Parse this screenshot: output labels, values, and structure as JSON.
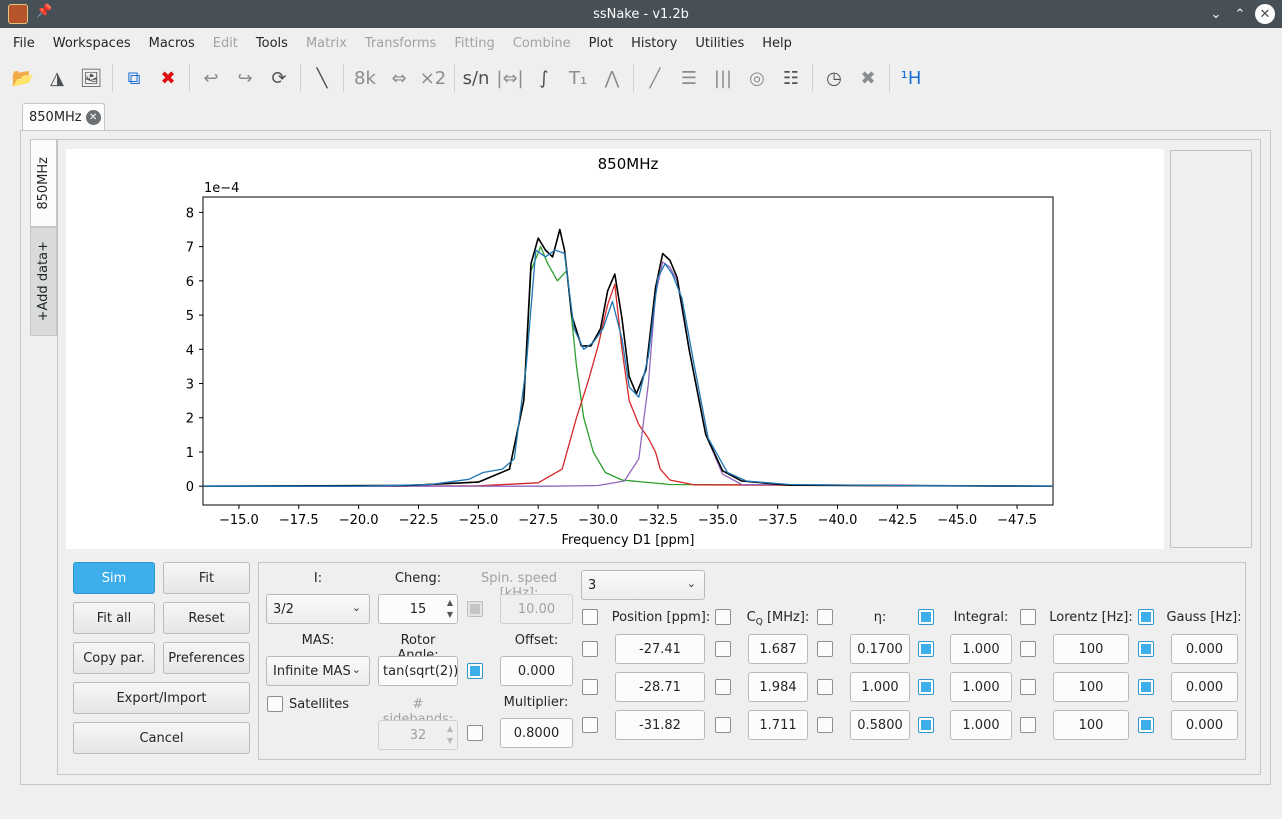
{
  "window": {
    "title": "ssNake - v1.2b"
  },
  "menu": [
    "File",
    "Workspaces",
    "Macros",
    "Edit",
    "Tools",
    "Matrix",
    "Transforms",
    "Fitting",
    "Combine",
    "Plot",
    "History",
    "Utilities",
    "Help"
  ],
  "menu_disabled": [
    "Edit",
    "Matrix",
    "Transforms",
    "Fitting",
    "Combine"
  ],
  "toolbar": [
    {
      "name": "open-icon",
      "glyph": "📂",
      "style": "dark"
    },
    {
      "name": "nmr-icon",
      "glyph": "◮",
      "style": "dark"
    },
    {
      "name": "image-icon",
      "glyph": "🖼",
      "style": "dark"
    },
    {
      "sep": true
    },
    {
      "name": "copy-icon",
      "glyph": "⧉",
      "style": "blue"
    },
    {
      "name": "delete-icon",
      "glyph": "✖",
      "style": "red"
    },
    {
      "sep": true
    },
    {
      "name": "undo-icon",
      "glyph": "↩",
      "style": ""
    },
    {
      "name": "redo-icon",
      "glyph": "↪",
      "style": ""
    },
    {
      "name": "reload-icon",
      "glyph": "⟳",
      "style": "dark"
    },
    {
      "sep": true
    },
    {
      "name": "phase-icon",
      "glyph": "╲",
      "style": "dark"
    },
    {
      "sep": true
    },
    {
      "name": "8k-icon",
      "glyph": "8k",
      "style": ""
    },
    {
      "name": "shift-icon",
      "glyph": "⇔",
      "style": ""
    },
    {
      "name": "x2-icon",
      "glyph": "×2",
      "style": ""
    },
    {
      "sep": true
    },
    {
      "name": "snr-icon",
      "glyph": "s/n",
      "style": "dark"
    },
    {
      "name": "fwhm-icon",
      "glyph": "|⇔|",
      "style": ""
    },
    {
      "name": "integral-icon",
      "glyph": "∫",
      "style": "dark"
    },
    {
      "name": "t1-icon",
      "glyph": "T₁",
      "style": ""
    },
    {
      "name": "peak-icon",
      "glyph": "⋀",
      "style": ""
    },
    {
      "sep": true
    },
    {
      "name": "diagonal-icon",
      "glyph": "╱",
      "style": ""
    },
    {
      "name": "stack-icon",
      "glyph": "☰",
      "style": ""
    },
    {
      "name": "array-icon",
      "glyph": "|||",
      "style": ""
    },
    {
      "name": "contour-icon",
      "glyph": "◎",
      "style": ""
    },
    {
      "name": "multi-icon",
      "glyph": "☷",
      "style": "dark"
    },
    {
      "sep": true
    },
    {
      "name": "clock-icon",
      "glyph": "◷",
      "style": "dark"
    },
    {
      "name": "cross-icon",
      "glyph": "✖",
      "style": ""
    },
    {
      "sep": true
    },
    {
      "name": "nucleus-icon",
      "glyph": "¹H",
      "style": "blue"
    }
  ],
  "workspace_tab": "850MHz",
  "side_tabs": {
    "active": "850MHz",
    "add": "+Add data+"
  },
  "chart_data": {
    "type": "line",
    "title": "850MHz",
    "xlabel": "Frequency D1 [ppm]",
    "ylabel": "",
    "y_scale_label": "1e−4",
    "xlim": [
      -13.5,
      -49
    ],
    "ylim": [
      -0.55,
      8.45
    ],
    "xticks": [
      -15.0,
      -17.5,
      -20.0,
      -22.5,
      -25.0,
      -27.5,
      -30.0,
      -32.5,
      -35.0,
      -37.5,
      -40.0,
      -42.5,
      -45.0,
      -47.5
    ],
    "xtick_labels": [
      "−15.0",
      "−17.5",
      "−20.0",
      "−22.5",
      "−25.0",
      "−27.5",
      "−30.0",
      "−32.5",
      "−35.0",
      "−37.5",
      "−40.0",
      "−42.5",
      "−45.0",
      "−47.5"
    ],
    "yticks": [
      0,
      1,
      2,
      3,
      4,
      5,
      6,
      7,
      8
    ],
    "series": [
      {
        "color": "#2ca02c",
        "x": [
          -13.5,
          -22,
          -25,
          -26.3,
          -26.9,
          -27.2,
          -27.6,
          -27.9,
          -28.3,
          -28.7,
          -29.1,
          -29.4,
          -29.8,
          -30.3,
          -31,
          -33,
          -49
        ],
        "y": [
          0,
          0.02,
          0.12,
          0.5,
          2.5,
          6.3,
          7.0,
          6.5,
          6.0,
          6.3,
          3.5,
          2.0,
          1.0,
          0.4,
          0.18,
          0.05,
          0
        ]
      },
      {
        "color": "#d62728",
        "x": [
          -13.5,
          -25,
          -27.5,
          -28.5,
          -29.1,
          -29.6,
          -30.0,
          -30.4,
          -30.7,
          -31.0,
          -31.3,
          -31.7,
          -32.1,
          -32.4,
          -32.6,
          -33,
          -34,
          -49
        ],
        "y": [
          0,
          0.01,
          0.1,
          0.5,
          2.0,
          3.1,
          4.1,
          5.3,
          5.9,
          4.0,
          2.5,
          1.8,
          1.4,
          1.0,
          0.5,
          0.18,
          0.04,
          0
        ]
      },
      {
        "color": "#9467bd",
        "x": [
          -13.5,
          -28,
          -30,
          -31.1,
          -31.7,
          -32.1,
          -32.4,
          -32.7,
          -33.0,
          -33.3,
          -33.8,
          -34.5,
          -35.2,
          -36,
          -49
        ],
        "y": [
          0,
          0.0,
          0.02,
          0.15,
          0.8,
          3.0,
          5.6,
          6.55,
          6.4,
          6.0,
          4.0,
          1.5,
          0.35,
          0.05,
          0
        ]
      },
      {
        "color": "#000000",
        "x": [
          -13.5,
          -22,
          -25,
          -26.3,
          -26.9,
          -27.2,
          -27.5,
          -27.8,
          -28.1,
          -28.4,
          -28.6,
          -28.9,
          -29.3,
          -29.7,
          -30.1,
          -30.4,
          -30.7,
          -31.0,
          -31.3,
          -31.6,
          -32.0,
          -32.4,
          -32.7,
          -33.0,
          -33.3,
          -33.8,
          -34.5,
          -35.2,
          -36,
          -38,
          -49
        ],
        "y": [
          0,
          0.02,
          0.12,
          0.5,
          2.5,
          6.5,
          7.25,
          6.9,
          6.7,
          7.5,
          6.9,
          5.0,
          4.1,
          4.1,
          4.6,
          5.7,
          6.2,
          4.9,
          3.2,
          2.7,
          3.4,
          5.8,
          6.8,
          6.6,
          6.1,
          4.0,
          1.5,
          0.45,
          0.15,
          0.03,
          0
        ]
      },
      {
        "color": "#1f77b4",
        "x": [
          -13.5,
          -20,
          -23,
          -24.6,
          -25.2,
          -26.0,
          -26.5,
          -27.0,
          -27.4,
          -27.8,
          -28.2,
          -28.6,
          -29.0,
          -29.4,
          -29.8,
          -30.2,
          -30.6,
          -31.0,
          -31.3,
          -31.7,
          -32.1,
          -32.5,
          -32.8,
          -33.1,
          -33.5,
          -34.0,
          -34.6,
          -35.4,
          -36.2,
          -38,
          -42,
          -49
        ],
        "y": [
          0,
          0.0,
          0.05,
          0.2,
          0.4,
          0.5,
          0.8,
          3.5,
          6.9,
          6.7,
          6.9,
          6.8,
          4.6,
          4.0,
          4.2,
          4.6,
          5.4,
          4.3,
          2.9,
          2.6,
          3.8,
          6.1,
          6.5,
          6.2,
          5.5,
          3.6,
          1.4,
          0.4,
          0.15,
          0.05,
          0.02,
          0
        ]
      }
    ]
  },
  "buttons": {
    "sim": "Sim",
    "fit": "Fit",
    "fit_all": "Fit all",
    "reset": "Reset",
    "copy_par": "Copy par.",
    "preferences": "Preferences",
    "export_import": "Export/Import",
    "cancel": "Cancel"
  },
  "params": {
    "i_label": "I:",
    "i_value": "3/2",
    "cheng_label": "Cheng:",
    "cheng_value": "15",
    "spin_label": "Spin. speed [kHz]:",
    "spin_value": "10.00",
    "mas_label": "MAS:",
    "mas_value": "Infinite MAS",
    "rotor_label": "Rotor Angle:",
    "rotor_value": "tan(sqrt(2))",
    "offset_label": "Offset:",
    "offset_value": "0.000",
    "satellites_label": "Satellites",
    "sidebands_label": "# sidebands:",
    "sidebands_value": "32",
    "multiplier_label": "Multiplier:",
    "multiplier_value": "0.8000",
    "sites_value": "3",
    "headers": {
      "position": "Position [ppm]:",
      "cq": "C",
      "cq_sub": "Q",
      "cq_unit": " [MHz]:",
      "eta": "η:",
      "integral": "Integral:",
      "lorentz": "Lorentz [Hz]:",
      "gauss": "Gauss [Hz]:"
    },
    "rows": [
      {
        "position": "-27.41",
        "cq": "1.687",
        "eta": "0.1700",
        "integral": "1.000",
        "lorentz": "100",
        "gauss": "0.000"
      },
      {
        "position": "-28.71",
        "cq": "1.984",
        "eta": "1.000",
        "integral": "1.000",
        "lorentz": "100",
        "gauss": "0.000"
      },
      {
        "position": "-31.82",
        "cq": "1.711",
        "eta": "0.5800",
        "integral": "1.000",
        "lorentz": "100",
        "gauss": "0.000"
      }
    ]
  }
}
